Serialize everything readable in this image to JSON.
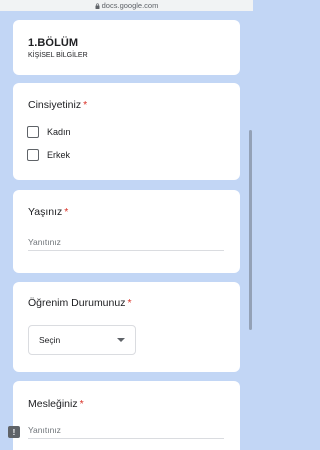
{
  "browser": {
    "url": "docs.google.com",
    "lock_icon": "lock-icon"
  },
  "section": {
    "title": "1.BÖLÜM",
    "subtitle": "KİŞİSEL BİLGİLER"
  },
  "questions": {
    "gender": {
      "title": "Cinsiyetiniz",
      "required_mark": "*",
      "options": [
        "Kadın",
        "Erkek"
      ]
    },
    "age": {
      "title": "Yaşınız",
      "required_mark": "*",
      "placeholder": "Yanıtınız"
    },
    "education": {
      "title": "Öğrenim Durumunuz",
      "required_mark": "*",
      "select_value": "Seçin"
    },
    "job": {
      "title": "Mesleğiniz",
      "required_mark": "*",
      "placeholder": "Yanıtınız"
    }
  },
  "feedback_icon": {
    "name": "feedback-icon",
    "glyph": "!"
  },
  "colors": {
    "background": "#c2d6f5",
    "required": "#d93025",
    "card": "#ffffff"
  }
}
